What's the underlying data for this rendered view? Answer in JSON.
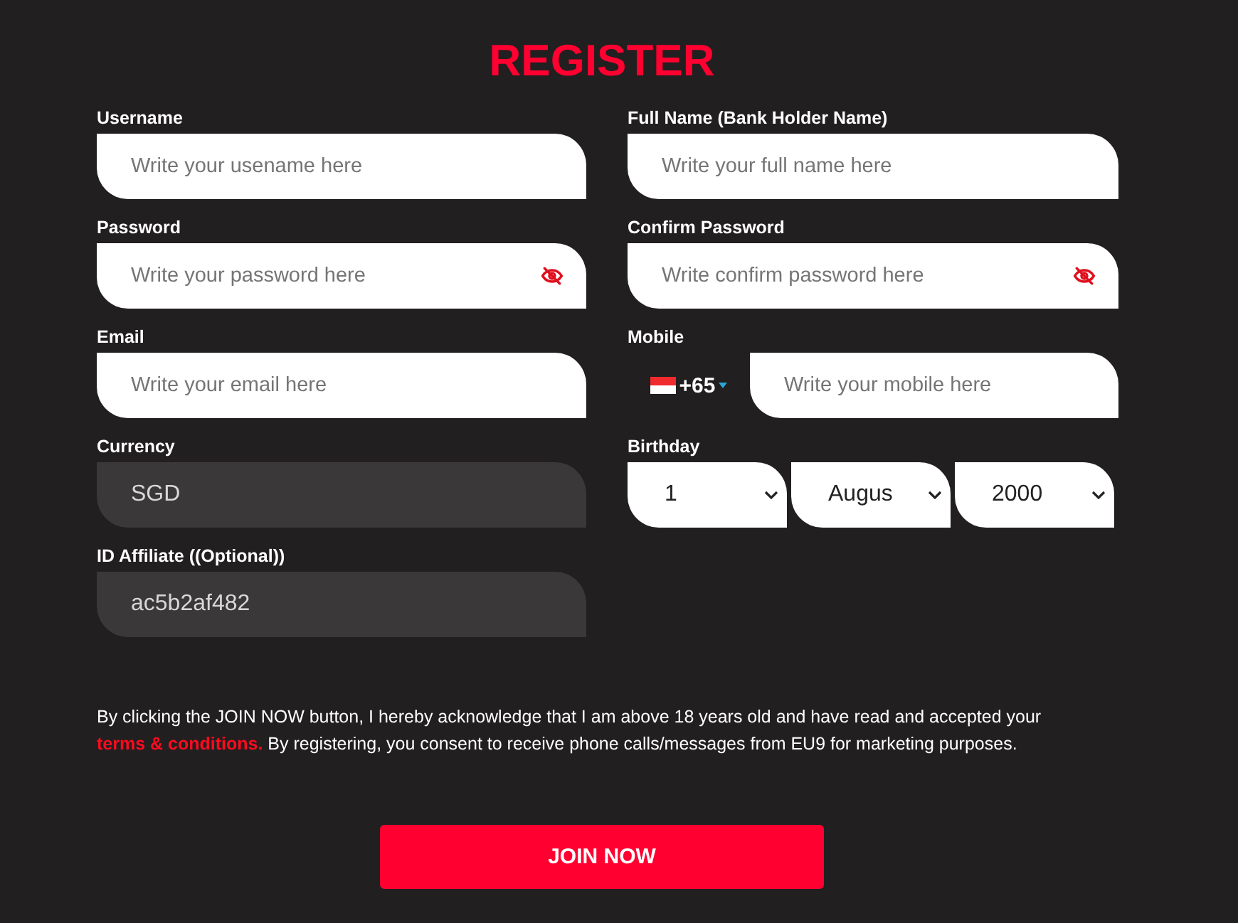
{
  "title": "REGISTER",
  "fields": [
    {
      "kind": "text",
      "label": "Username",
      "placeholder": "Write your usename here"
    },
    {
      "kind": "text",
      "label": "Full Name (Bank Holder Name)",
      "placeholder": "Write your full name here"
    },
    {
      "kind": "password",
      "label": "Password",
      "placeholder": "Write your password here"
    },
    {
      "kind": "password",
      "label": "Confirm Password",
      "placeholder": "Write confirm password here"
    },
    {
      "kind": "text",
      "label": "Email",
      "placeholder": "Write your email here"
    },
    {
      "kind": "mobile",
      "label": "Mobile",
      "code": "+65",
      "placeholder": "Write your mobile here"
    },
    {
      "kind": "readonly",
      "label": "Currency",
      "value": "SGD"
    },
    {
      "kind": "birthday",
      "label": "Birthday",
      "selects": [
        "1",
        "Augus",
        "2000"
      ]
    },
    {
      "kind": "readonly",
      "label": "ID Affiliate ((Optional))",
      "value": "ac5b2af482"
    }
  ],
  "consent": {
    "before": "By clicking the JOIN NOW button, I hereby acknowledge that I am above 18 years old and have read and accepted your",
    "link": "terms & conditions.",
    "after": "By registering, you consent to receive phone calls/messages from EU9 for marketing purposes."
  },
  "submit": "JOIN NOW"
}
